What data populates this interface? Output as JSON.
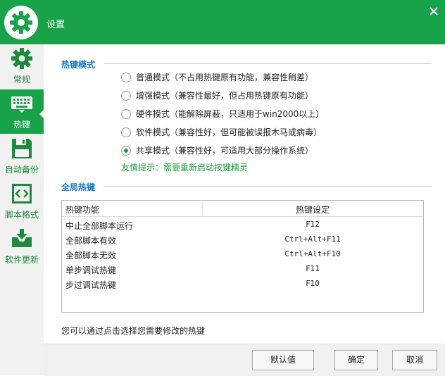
{
  "window": {
    "title": "设置"
  },
  "sidebar": {
    "items": [
      {
        "label": "常规",
        "icon": "gear-icon"
      },
      {
        "label": "热键",
        "icon": "keyboard-icon"
      },
      {
        "label": "自动备份",
        "icon": "save-icon"
      },
      {
        "label": "脚本格式",
        "icon": "code-icon"
      },
      {
        "label": "软件更新",
        "icon": "update-icon"
      }
    ],
    "active": "热键"
  },
  "hotkey_mode": {
    "title": "热键模式",
    "options": [
      {
        "label": "普通模式（不占用热键原有功能，兼容性稍差）",
        "checked": false
      },
      {
        "label": "增强模式（兼容性最好，但占用热键原有功能）",
        "checked": false
      },
      {
        "label": "硬件模式（能解除屏蔽，只适用于win2000以上）",
        "checked": false
      },
      {
        "label": "软件模式（兼容性好，但可能被误报木马或病毒）",
        "checked": false
      },
      {
        "label": "共享模式（兼容性好，可适用大部分操作系统）",
        "checked": true
      }
    ],
    "hint": "友情提示：需要重新启动按键精灵"
  },
  "global_hotkeys": {
    "title": "全局热键",
    "columns": [
      "热键功能",
      "热键设定"
    ],
    "rows": [
      {
        "function": "中止全部脚本运行",
        "key": "F12"
      },
      {
        "function": "全部脚本有效",
        "key": "Ctrl+Alt+F11"
      },
      {
        "function": "全部脚本无效",
        "key": "Ctrl+Alt+F10"
      },
      {
        "function": "单步调试热键",
        "key": "F11"
      },
      {
        "function": "步过调试热键",
        "key": "F10"
      }
    ],
    "note": "您可以通过点击选择您需要修改的热键"
  },
  "buttons": {
    "default": "默认值",
    "ok": "确定",
    "cancel": "取消"
  },
  "colors": {
    "brand": "#18a24a",
    "section_title": "#1778c4",
    "hint": "#1f9b3a"
  }
}
